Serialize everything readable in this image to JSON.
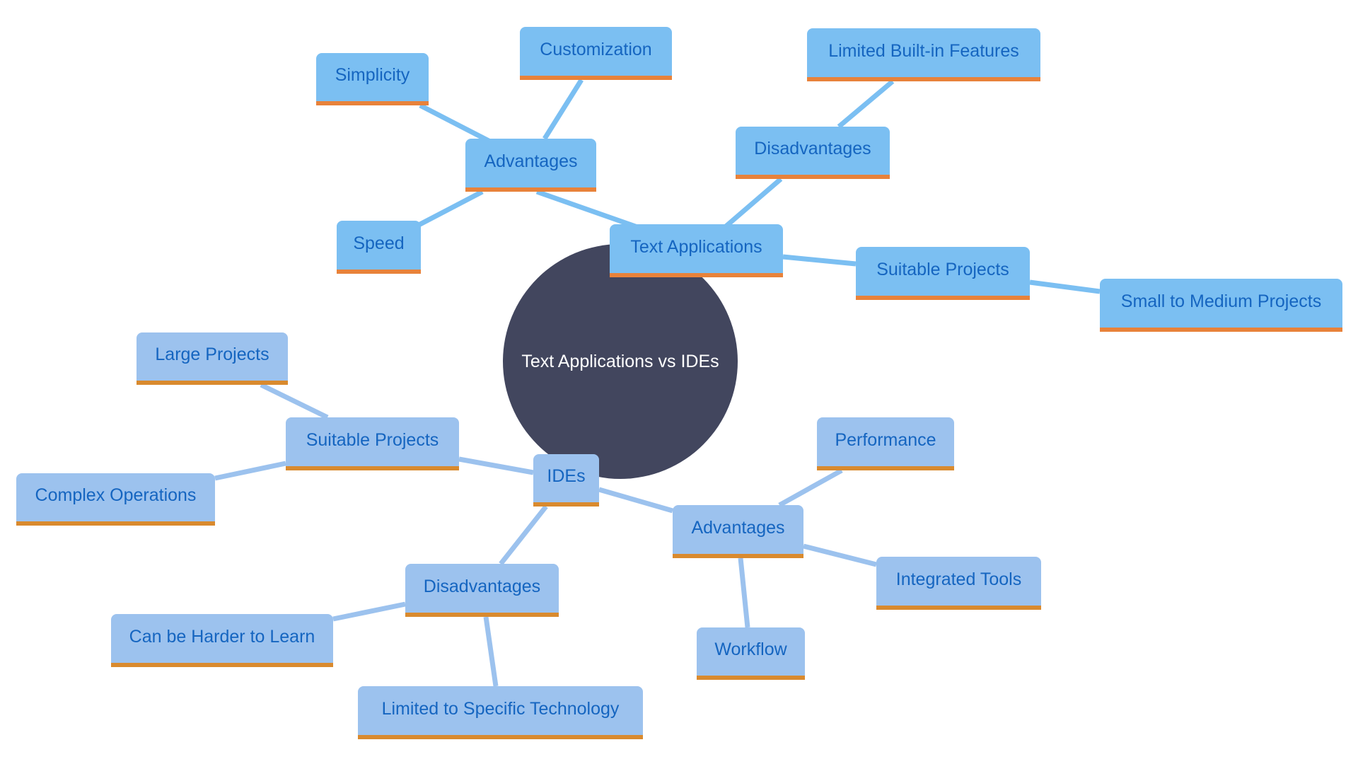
{
  "colors": {
    "text_apps_fill": "#7bbff2",
    "text_apps_line": "#7bbff2",
    "ides_fill": "#9cc2ee",
    "ides_line": "#9cc2ee",
    "accent_border_text_apps": "#e8823a",
    "accent_border_ides": "#d98a2e",
    "node_text": "#1565c0",
    "center_fill": "#42465e",
    "center_text": "#ffffff"
  },
  "root": {
    "label": "Text Applications vs IDEs"
  },
  "text_applications": {
    "label": "Text Applications",
    "advantages": {
      "label": "Advantages",
      "items": [
        "Customization",
        "Simplicity",
        "Speed"
      ]
    },
    "disadvantages": {
      "label": "Disadvantages",
      "items": [
        "Limited Built-in Features"
      ]
    },
    "suitable_projects": {
      "label": "Suitable Projects",
      "items": [
        "Small to Medium Projects"
      ]
    }
  },
  "ides": {
    "label": "IDEs",
    "suitable_projects": {
      "label": "Suitable Projects",
      "items": [
        "Large Projects",
        "Complex Operations"
      ]
    },
    "advantages": {
      "label": "Advantages",
      "items": [
        "Performance",
        "Integrated Tools",
        "Workflow"
      ]
    },
    "disadvantages": {
      "label": "Disadvantages",
      "items": [
        "Can be Harder to Learn",
        "Limited to Specific Technology"
      ]
    }
  }
}
